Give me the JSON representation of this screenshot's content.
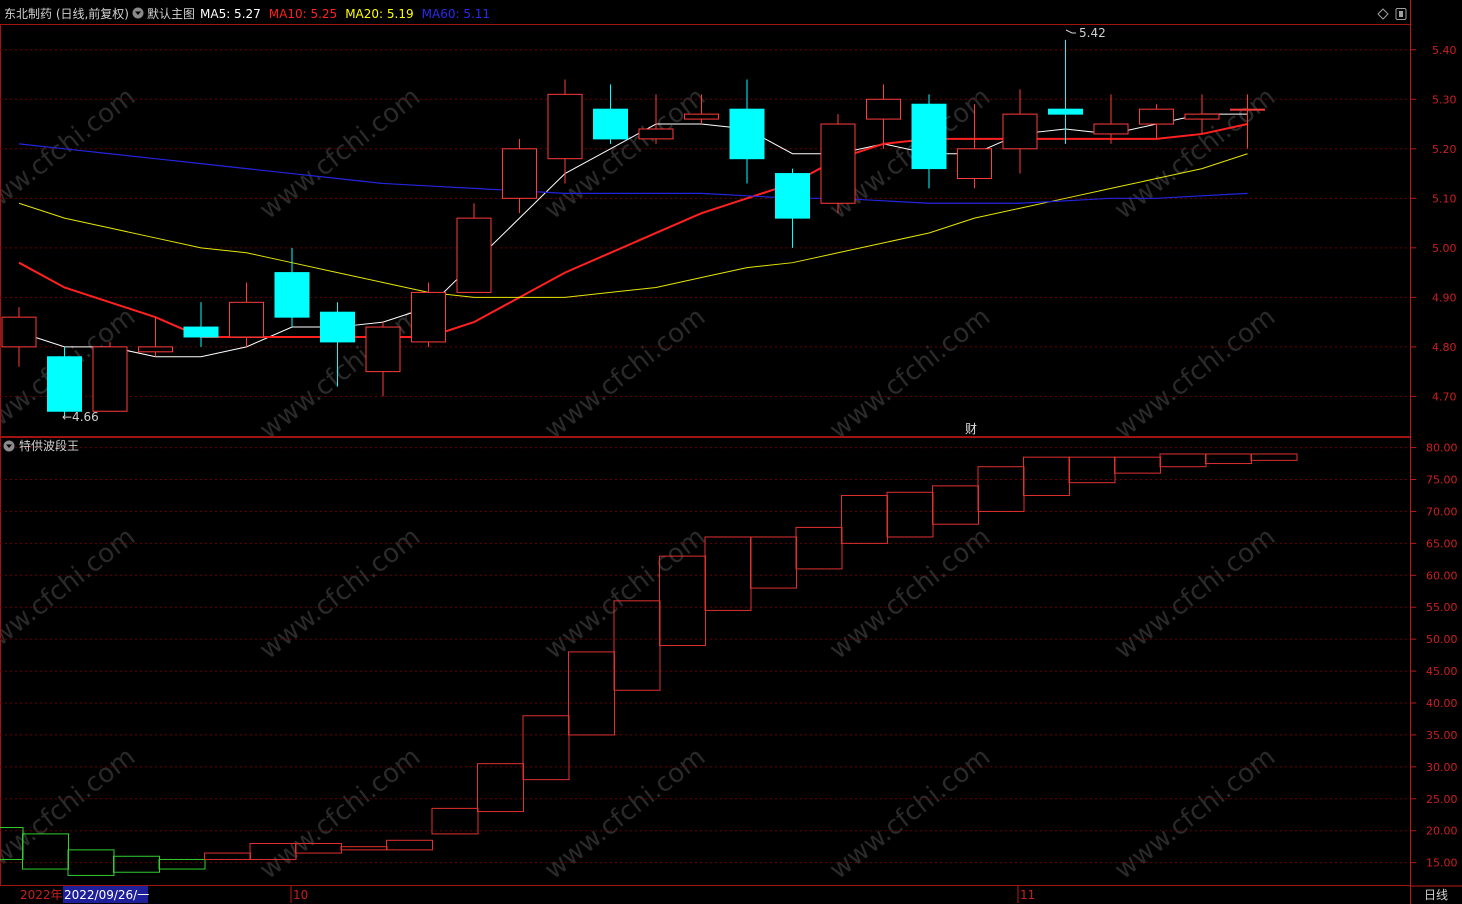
{
  "header": {
    "stock_title": "东北制药 (日线,前复权)",
    "main_chart_label": "默认主图",
    "ma_labels": [
      {
        "name": "MA5",
        "value": "5.27",
        "color": "#ffffff"
      },
      {
        "name": "MA10",
        "value": "5.25",
        "color": "#ff2020"
      },
      {
        "name": "MA20",
        "value": "5.19",
        "color": "#ffff00"
      },
      {
        "name": "MA60",
        "value": "5.11",
        "color": "#2a2af0"
      }
    ]
  },
  "indicator": {
    "title": "特供波段王"
  },
  "annotations": {
    "high_label": "5.42",
    "low_label": "←4.66",
    "cai_marker": "财"
  },
  "date_axis": {
    "year_label": "2022年",
    "cursor_date": "2022/09/26/一",
    "month_labels": [
      "10",
      "11"
    ]
  },
  "period_button": "日线",
  "watermark": "www.cfchi.com",
  "colors": {
    "up": "#ff3b3b",
    "down": "#00ffff",
    "grid": "#6a0000",
    "axis": "#c01818"
  },
  "chart_data": [
    {
      "type": "candlestick",
      "name": "price",
      "y_ticks": [
        "5.40",
        "5.30",
        "5.20",
        "5.10",
        "5.00",
        "4.90",
        "4.80",
        "4.70"
      ],
      "ylim": [
        4.62,
        5.45
      ],
      "candles": [
        {
          "o": 4.8,
          "h": 4.88,
          "l": 4.76,
          "c": 4.86
        },
        {
          "o": 4.78,
          "h": 4.8,
          "l": 4.66,
          "c": 4.67
        },
        {
          "o": 4.67,
          "h": 4.81,
          "l": 4.67,
          "c": 4.8
        },
        {
          "o": 4.79,
          "h": 4.86,
          "l": 4.78,
          "c": 4.8
        },
        {
          "o": 4.84,
          "h": 4.89,
          "l": 4.8,
          "c": 4.82
        },
        {
          "o": 4.82,
          "h": 4.93,
          "l": 4.8,
          "c": 4.89
        },
        {
          "o": 4.95,
          "h": 5.0,
          "l": 4.84,
          "c": 4.86
        },
        {
          "o": 4.87,
          "h": 4.89,
          "l": 4.72,
          "c": 4.81
        },
        {
          "o": 4.75,
          "h": 4.85,
          "l": 4.7,
          "c": 4.84
        },
        {
          "o": 4.81,
          "h": 4.93,
          "l": 4.8,
          "c": 4.91
        },
        {
          "o": 4.91,
          "h": 5.09,
          "l": 4.91,
          "c": 5.06
        },
        {
          "o": 5.1,
          "h": 5.22,
          "l": 5.07,
          "c": 5.2
        },
        {
          "o": 5.18,
          "h": 5.34,
          "l": 5.13,
          "c": 5.31
        },
        {
          "o": 5.28,
          "h": 5.33,
          "l": 5.21,
          "c": 5.22
        },
        {
          "o": 5.22,
          "h": 5.31,
          "l": 5.21,
          "c": 5.24
        },
        {
          "o": 5.26,
          "h": 5.31,
          "l": 5.25,
          "c": 5.27
        },
        {
          "o": 5.28,
          "h": 5.34,
          "l": 5.13,
          "c": 5.18
        },
        {
          "o": 5.15,
          "h": 5.16,
          "l": 5.0,
          "c": 5.06
        },
        {
          "o": 5.09,
          "h": 5.27,
          "l": 5.07,
          "c": 5.25
        },
        {
          "o": 5.26,
          "h": 5.33,
          "l": 5.2,
          "c": 5.3
        },
        {
          "o": 5.29,
          "h": 5.31,
          "l": 5.12,
          "c": 5.16
        },
        {
          "o": 5.14,
          "h": 5.29,
          "l": 5.12,
          "c": 5.2
        },
        {
          "o": 5.2,
          "h": 5.32,
          "l": 5.15,
          "c": 5.27
        },
        {
          "o": 5.28,
          "h": 5.42,
          "l": 5.21,
          "c": 5.27
        },
        {
          "o": 5.23,
          "h": 5.31,
          "l": 5.21,
          "c": 5.25
        },
        {
          "o": 5.25,
          "h": 5.29,
          "l": 5.22,
          "c": 5.28
        },
        {
          "o": 5.26,
          "h": 5.31,
          "l": 5.23,
          "c": 5.27
        },
        {
          "o": 5.28,
          "h": 5.31,
          "l": 5.2,
          "c": 5.28
        }
      ],
      "ma": {
        "MA5": [
          4.83,
          4.8,
          4.8,
          4.78,
          4.78,
          4.8,
          4.84,
          4.84,
          4.85,
          4.88,
          4.97,
          5.06,
          5.15,
          5.2,
          5.25,
          5.25,
          5.24,
          5.19,
          5.19,
          5.21,
          5.19,
          5.19,
          5.23,
          5.24,
          5.23,
          5.25,
          5.27,
          5.27
        ],
        "MA10": [
          4.97,
          4.92,
          4.89,
          4.86,
          4.82,
          4.82,
          4.82,
          4.82,
          4.82,
          4.82,
          4.85,
          4.9,
          4.95,
          4.99,
          5.03,
          5.07,
          5.1,
          5.13,
          5.18,
          5.21,
          5.22,
          5.22,
          5.22,
          5.22,
          5.22,
          5.22,
          5.23,
          5.25
        ],
        "MA20": [
          5.09,
          5.06,
          5.04,
          5.02,
          5.0,
          4.99,
          4.97,
          4.95,
          4.93,
          4.91,
          4.9,
          4.9,
          4.9,
          4.91,
          4.92,
          4.94,
          4.96,
          4.97,
          4.99,
          5.01,
          5.03,
          5.06,
          5.08,
          5.1,
          5.12,
          5.14,
          5.16,
          5.19
        ],
        "MA60": [
          5.21,
          5.2,
          5.19,
          5.18,
          5.17,
          5.16,
          5.15,
          5.14,
          5.13,
          5.125,
          5.12,
          5.115,
          5.11,
          5.11,
          5.11,
          5.11,
          5.105,
          5.1,
          5.1,
          5.095,
          5.09,
          5.09,
          5.09,
          5.095,
          5.1,
          5.1,
          5.105,
          5.11
        ]
      }
    },
    {
      "type": "box",
      "name": "特供波段王",
      "y_ticks": [
        "80.00",
        "75.00",
        "70.00",
        "65.00",
        "60.00",
        "55.00",
        "50.00",
        "45.00",
        "40.00",
        "35.00",
        "30.00",
        "25.00",
        "20.00",
        "15.00"
      ],
      "ylim": [
        11.5,
        81.5
      ],
      "boxes": [
        {
          "lo": 15.5,
          "hi": 20.5,
          "dir": "down"
        },
        {
          "lo": 14.0,
          "hi": 19.5,
          "dir": "down"
        },
        {
          "lo": 13.0,
          "hi": 17.0,
          "dir": "down"
        },
        {
          "lo": 13.5,
          "hi": 16.0,
          "dir": "down"
        },
        {
          "lo": 14.0,
          "hi": 15.5,
          "dir": "down"
        },
        {
          "lo": 15.5,
          "hi": 16.5,
          "dir": "up"
        },
        {
          "lo": 15.5,
          "hi": 18.0,
          "dir": "up"
        },
        {
          "lo": 16.5,
          "hi": 18.0,
          "dir": "up"
        },
        {
          "lo": 17.0,
          "hi": 17.5,
          "dir": "up"
        },
        {
          "lo": 17.0,
          "hi": 18.5,
          "dir": "up"
        },
        {
          "lo": 19.5,
          "hi": 23.5,
          "dir": "up"
        },
        {
          "lo": 23.0,
          "hi": 30.5,
          "dir": "up"
        },
        {
          "lo": 28.0,
          "hi": 38.0,
          "dir": "up"
        },
        {
          "lo": 35.0,
          "hi": 48.0,
          "dir": "up"
        },
        {
          "lo": 42.0,
          "hi": 56.0,
          "dir": "up"
        },
        {
          "lo": 49.0,
          "hi": 63.0,
          "dir": "up"
        },
        {
          "lo": 54.5,
          "hi": 66.0,
          "dir": "up"
        },
        {
          "lo": 58.0,
          "hi": 66.0,
          "dir": "up"
        },
        {
          "lo": 61.0,
          "hi": 67.5,
          "dir": "up"
        },
        {
          "lo": 65.0,
          "hi": 72.5,
          "dir": "up"
        },
        {
          "lo": 66.0,
          "hi": 73.0,
          "dir": "up"
        },
        {
          "lo": 68.0,
          "hi": 74.0,
          "dir": "up"
        },
        {
          "lo": 70.0,
          "hi": 77.0,
          "dir": "up"
        },
        {
          "lo": 72.5,
          "hi": 78.5,
          "dir": "up"
        },
        {
          "lo": 74.5,
          "hi": 78.5,
          "dir": "up"
        },
        {
          "lo": 76.0,
          "hi": 78.5,
          "dir": "up"
        },
        {
          "lo": 77.0,
          "hi": 79.0,
          "dir": "up"
        },
        {
          "lo": 77.5,
          "hi": 79.0,
          "dir": "up"
        },
        {
          "lo": 78.0,
          "hi": 79.0,
          "dir": "up"
        }
      ]
    }
  ]
}
